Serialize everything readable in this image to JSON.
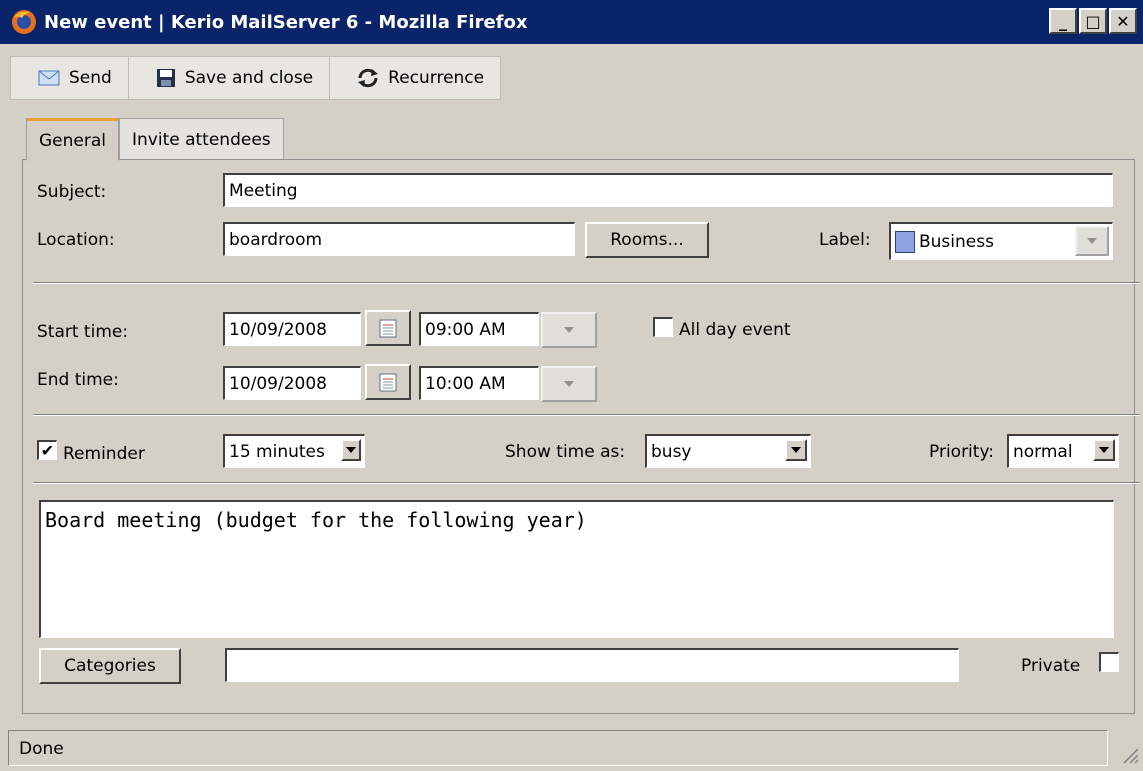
{
  "window": {
    "title": "New event | Kerio MailServer 6 - Mozilla Firefox",
    "min_symbol": "_",
    "max_symbol": "□",
    "close_symbol": "✕"
  },
  "toolbar": {
    "send_label": "Send",
    "save_close_label": "Save and close",
    "recurrence_label": "Recurrence"
  },
  "tabs": {
    "general": "General",
    "invite": "Invite attendees"
  },
  "form": {
    "subject_label": "Subject:",
    "subject_value": "Meeting",
    "location_label": "Location:",
    "location_value": "boardroom",
    "rooms_button": "Rooms...",
    "label_label": "Label:",
    "label_value": "Business",
    "label_color": "#8da4e0",
    "start_label": "Start time:",
    "start_date": "10/09/2008",
    "start_time": "09:00 AM",
    "all_day_label": "All day event",
    "end_label": "End time:",
    "end_date": "10/09/2008",
    "end_time": "10:00 AM",
    "reminder_label": "Reminder",
    "reminder_checked": true,
    "reminder_value": "15 minutes",
    "show_time_label": "Show time as:",
    "show_time_value": "busy",
    "priority_label": "Priority:",
    "priority_value": "normal",
    "description": "Board meeting (budget for the following year)",
    "categories_button": "Categories",
    "categories_value": "",
    "private_label": "Private"
  },
  "status": {
    "text": "Done"
  }
}
